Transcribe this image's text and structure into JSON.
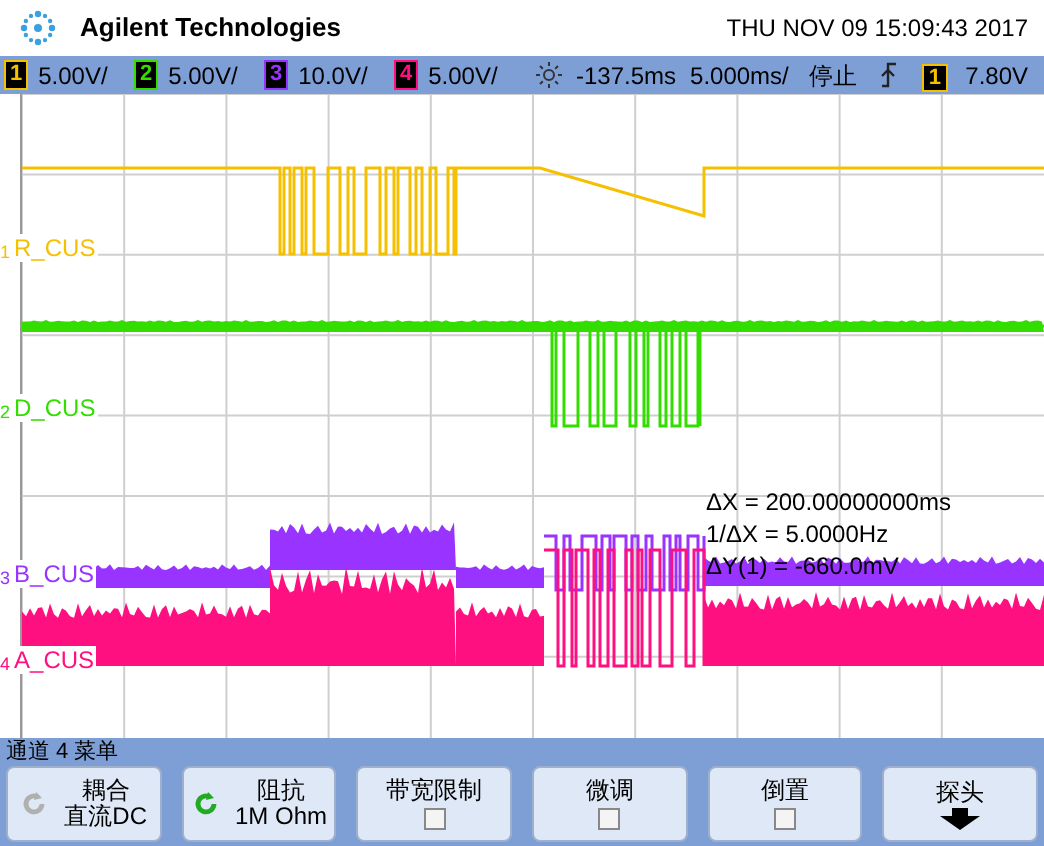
{
  "header": {
    "brand": "Agilent Technologies",
    "datetime": "THU NOV 09 15:09:43 2017"
  },
  "status_bar": {
    "channels": [
      {
        "number": "1",
        "scale": "5.00V/",
        "color": "#f5c000"
      },
      {
        "number": "2",
        "scale": "5.00V/",
        "color": "#33dd00"
      },
      {
        "number": "3",
        "scale": "10.0V/",
        "color": "#9933ff"
      },
      {
        "number": "4",
        "scale": "5.00V/",
        "color": "#ff1080"
      }
    ],
    "time_offset": "-137.5ms",
    "timebase": "5.000ms/",
    "run_state": "停止",
    "trigger": {
      "source": "1",
      "color": "#f5c000",
      "level": "7.80V"
    }
  },
  "traces": [
    {
      "number": "1",
      "name": "R_CUS",
      "color": "#f5c000"
    },
    {
      "number": "2",
      "name": "D_CUS",
      "color": "#33dd00"
    },
    {
      "number": "3",
      "name": "B_CUS",
      "color": "#9933ff"
    },
    {
      "number": "4",
      "name": "A_CUS",
      "color": "#ff1080"
    }
  ],
  "cursor_readouts": [
    "ΔX = 200.00000000ms",
    "1/ΔX = 5.0000Hz",
    "ΔY(1) = -660.0mV"
  ],
  "menu": {
    "title": "通道 4 菜单",
    "softkeys": [
      {
        "kind": "cycle",
        "label": "耦合",
        "value": "直流DC",
        "enabled": false
      },
      {
        "kind": "cycle",
        "label": "阻抗",
        "value": "1M Ohm",
        "enabled": true
      },
      {
        "kind": "checkbox",
        "label": "带宽限制",
        "checked": false
      },
      {
        "kind": "checkbox",
        "label": "微调",
        "checked": false
      },
      {
        "kind": "checkbox",
        "label": "倒置",
        "checked": false
      },
      {
        "kind": "submenu",
        "label": "探头"
      }
    ]
  }
}
